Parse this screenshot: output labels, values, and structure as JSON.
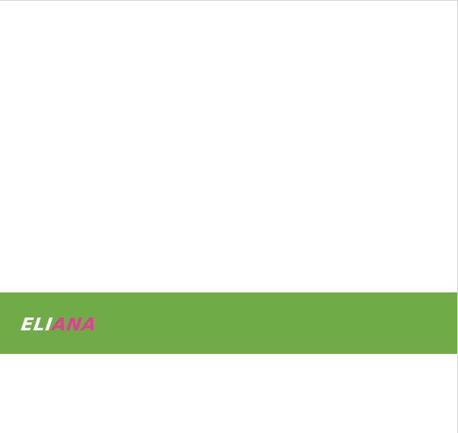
{
  "logo": {
    "part_1": "ELI",
    "part_2": "ANA"
  },
  "colors": {
    "banner_background": "#6fac47",
    "logo_primary": "#ffffff",
    "logo_accent": "#e0408f",
    "page_background": "#ffffff"
  }
}
